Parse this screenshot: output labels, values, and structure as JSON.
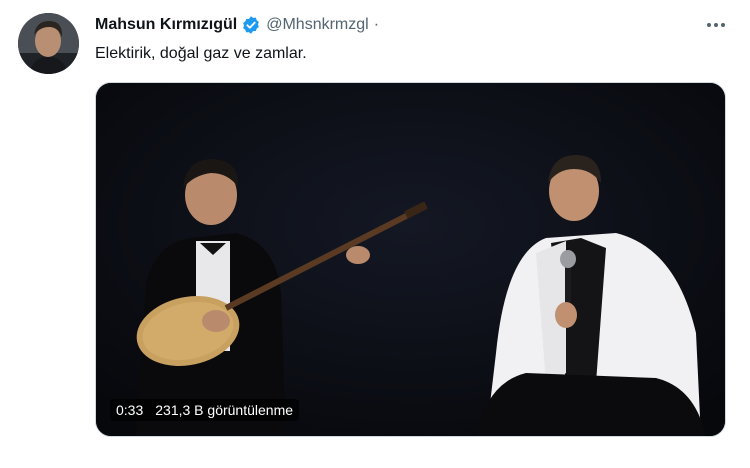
{
  "tweet": {
    "author": {
      "display_name": "Mahsun Kırmızıgül",
      "handle": "@Mhsnkrmzgl",
      "verified": true,
      "separator": "·"
    },
    "text": "Elektirik, doğal gaz ve zamlar.",
    "media": {
      "type": "video",
      "duration": "0:33",
      "views": "231,3 B görüntülenme"
    }
  },
  "colors": {
    "verified_badge": "#1d9bf0",
    "secondary_text": "#536471",
    "primary_text": "#0f1419",
    "video_background": "#0c0e14"
  },
  "icons": {
    "more": "more-horizontal-icon",
    "verified": "verified-badge-icon"
  }
}
